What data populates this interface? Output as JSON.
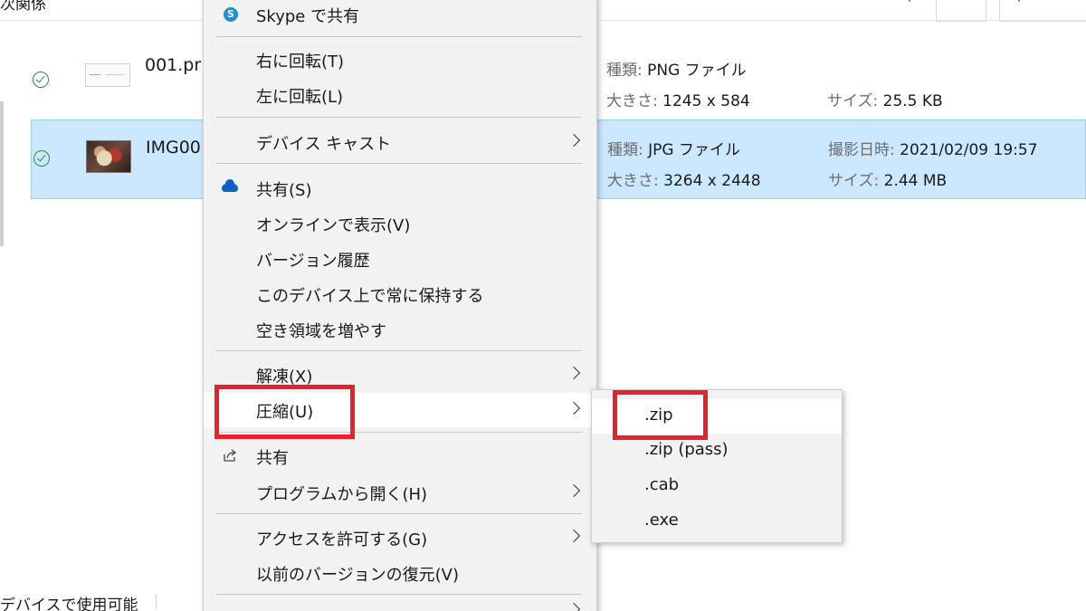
{
  "topbar": {
    "title": "次関係"
  },
  "files": [
    {
      "name": "001.pr",
      "type_key": "種類:",
      "type_value": "PNG ファイル",
      "dim_key": "大きさ:",
      "dim_value": "1245 x 584",
      "size_key": "サイズ:",
      "size_value": "25.5 KB",
      "selected": false
    },
    {
      "name": "IMG00",
      "type_key": "種類:",
      "type_value": "JPG ファイル",
      "date_key": "撮影日時:",
      "date_value": "2021/02/09 19:57",
      "dim_key": "大きさ:",
      "dim_value": "3264 x 2448",
      "size_key": "サイズ:",
      "size_value": "2.44 MB",
      "selected": true
    }
  ],
  "context_menu": {
    "items": [
      {
        "label": "Skype で共有",
        "icon": "skype-icon"
      },
      {
        "label": "右に回転(T)"
      },
      {
        "label": "左に回転(L)"
      },
      {
        "label": "デバイス キャスト",
        "submenu": true
      },
      {
        "label": "共有(S)",
        "icon": "onedrive-cloud-icon"
      },
      {
        "label": "オンラインで表示(V)"
      },
      {
        "label": "バージョン履歴"
      },
      {
        "label": "このデバイス上で常に保持する"
      },
      {
        "label": "空き領域を増やす"
      },
      {
        "label": "解凍(X)",
        "submenu": true
      },
      {
        "label": "圧縮(U)",
        "submenu": true,
        "hover": true
      },
      {
        "label": "共有",
        "icon": "share-icon"
      },
      {
        "label": "プログラムから開く(H)",
        "submenu": true
      },
      {
        "label": "アクセスを許可する(G)",
        "submenu": true
      },
      {
        "label": "以前のバージョンの復元(V)"
      }
    ]
  },
  "compress_submenu": {
    "items": [
      {
        "label": ".zip",
        "hover": true
      },
      {
        "label": ".zip (pass)"
      },
      {
        "label": ".cab"
      },
      {
        "label": ".exe"
      }
    ]
  },
  "status_bar": {
    "text": "デバイスで使用可能"
  },
  "colors": {
    "selection_bg": "#cce8ff",
    "menu_bg": "#f2f2f2",
    "highlight_red": "#e8212b",
    "sync_green": "#2e8b3a"
  }
}
